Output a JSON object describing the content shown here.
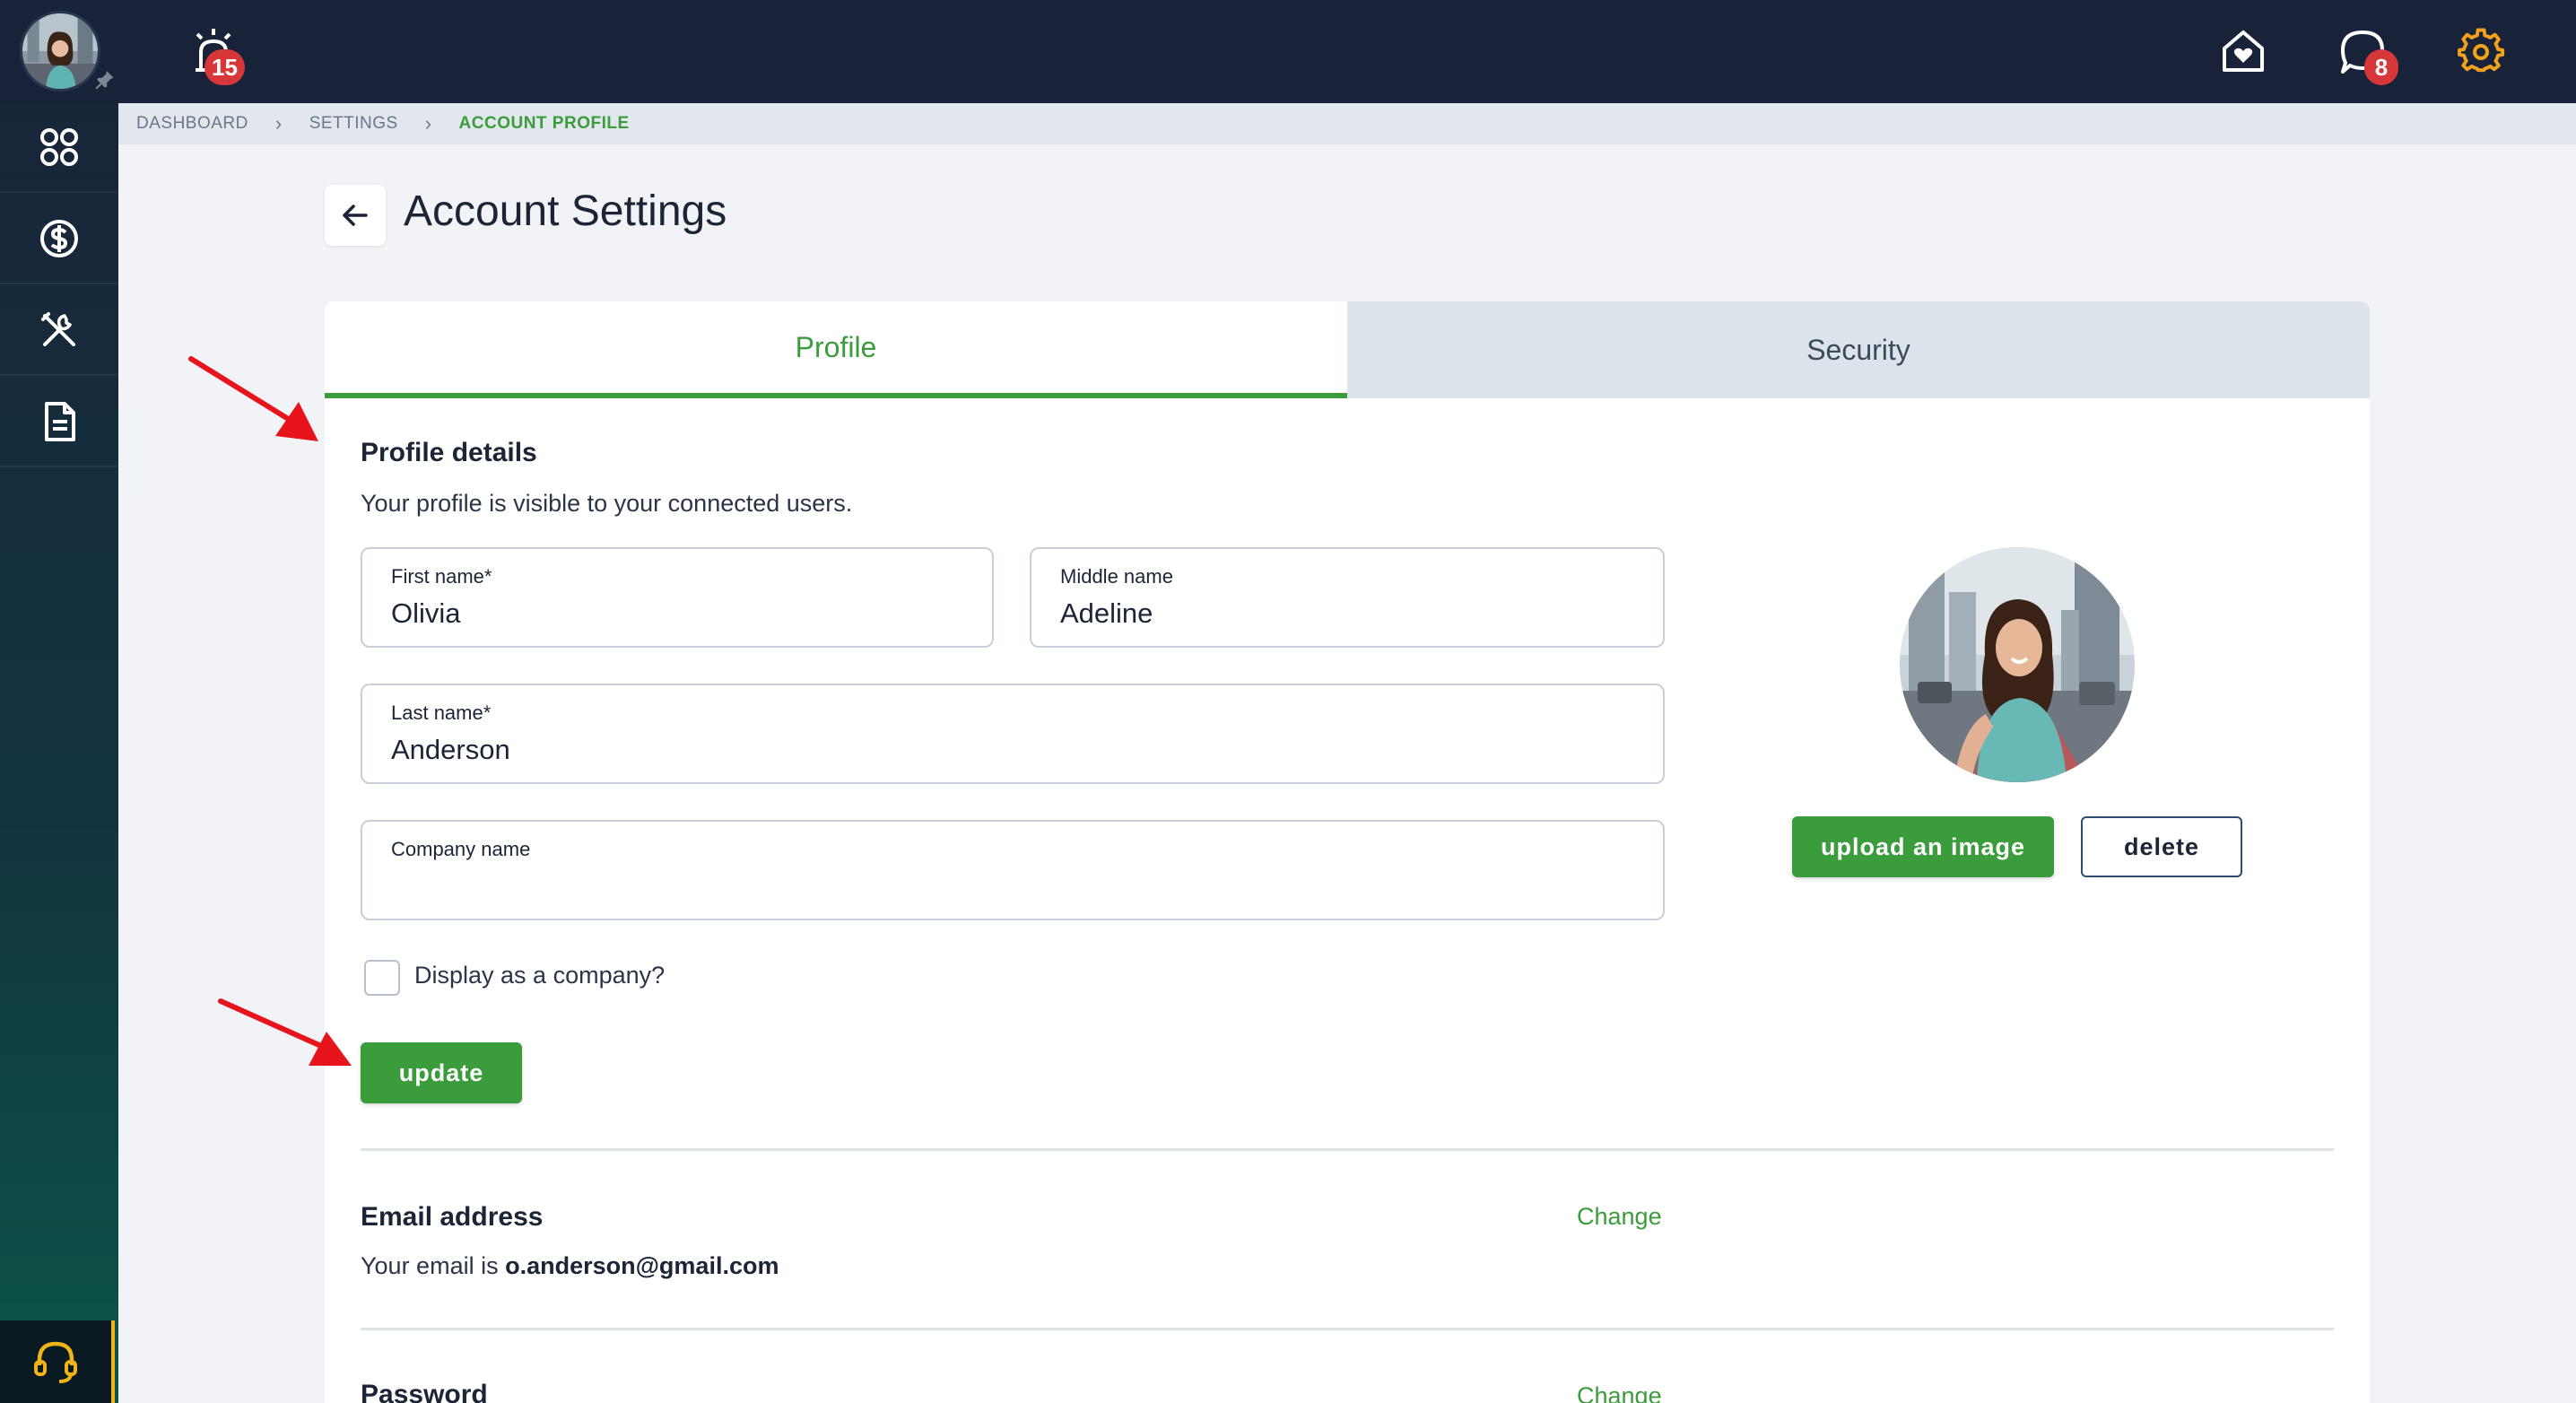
{
  "topbar": {
    "alarm_count": "15",
    "chat_count": "8"
  },
  "breadcrumb": {
    "items": [
      "DASHBOARD",
      "SETTINGS",
      "ACCOUNT PROFILE"
    ]
  },
  "page": {
    "title": "Account Settings"
  },
  "tabs": [
    {
      "label": "Profile",
      "active": true
    },
    {
      "label": "Security",
      "active": false
    }
  ],
  "profile": {
    "heading": "Profile details",
    "subtitle": "Your profile is visible to your connected users.",
    "first_name": {
      "label": "First name*",
      "value": "Olivia"
    },
    "middle_name": {
      "label": "Middle name",
      "value": "Adeline"
    },
    "last_name": {
      "label": "Last name*",
      "value": "Anderson"
    },
    "company_name": {
      "label": "Company name",
      "value": ""
    },
    "display_company_label": "Display as a company?",
    "update_label": "update",
    "upload_label": "upload an image",
    "delete_label": "delete"
  },
  "email": {
    "heading": "Email address",
    "prefix": "Your email is ",
    "value": "o.anderson@gmail.com",
    "change_label": "Change"
  },
  "password": {
    "heading": "Password",
    "change_label": "Change"
  },
  "colors": {
    "accent_green": "#3b9c3b",
    "topbar": "#182238",
    "badge_red": "#d8373a",
    "settings_orange": "#f2a21c",
    "annotation_red": "#e8141c"
  }
}
